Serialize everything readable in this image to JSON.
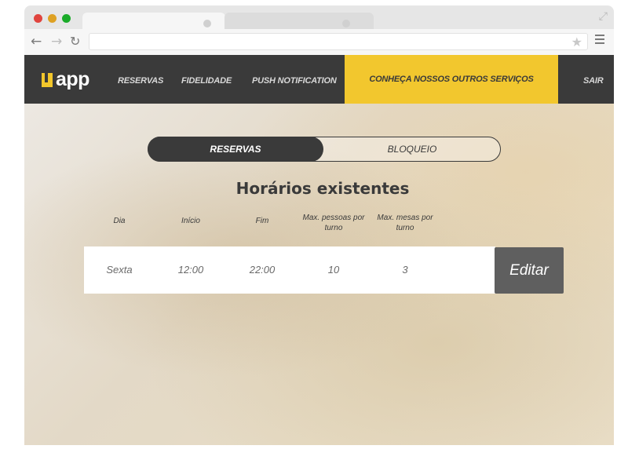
{
  "header": {
    "logo_text": "app",
    "nav": [
      "RESERVAS",
      "FIDELIDADE",
      "PUSH NOTIFICATION"
    ],
    "cta_label": "CONHEÇA NOSSOS OUTROS SERVIÇOS",
    "logout_label": "SAIR"
  },
  "toggle": {
    "active_label": "RESERVAS",
    "inactive_label": "BLOQUEIO"
  },
  "section_title": "Horários existentes",
  "table": {
    "headers": [
      "Dia",
      "Início",
      "Fim",
      "Max. pessoas por turno",
      "Max. mesas por turno"
    ],
    "rows": [
      [
        "Sexta",
        "12:00",
        "22:00",
        "10",
        "3"
      ]
    ],
    "edit_label": "Editar"
  },
  "browser": {
    "icons": [
      "back-arrow-icon",
      "forward-arrow-icon",
      "reload-icon",
      "star-icon",
      "menu-icon",
      "expand-icon"
    ]
  },
  "colors": {
    "accent": "#f2c72e",
    "dark": "#3a3a3a"
  }
}
